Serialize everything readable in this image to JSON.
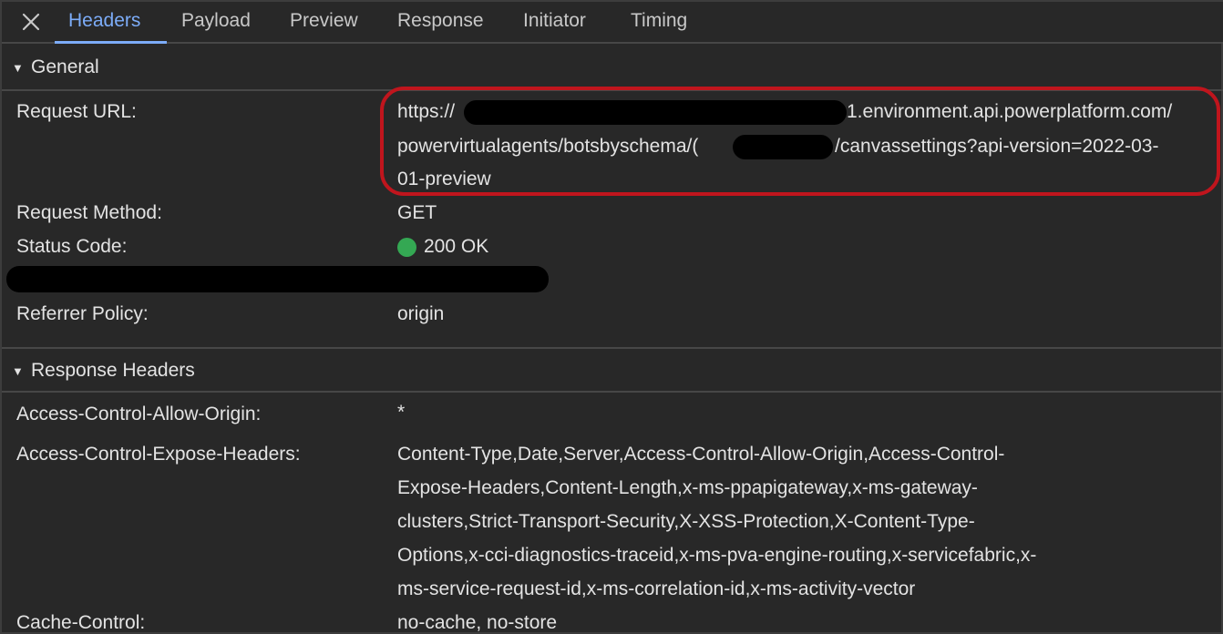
{
  "tabs": [
    {
      "label": "Headers",
      "active": true
    },
    {
      "label": "Payload",
      "active": false
    },
    {
      "label": "Preview",
      "active": false
    },
    {
      "label": "Response",
      "active": false
    },
    {
      "label": "Initiator",
      "active": false
    },
    {
      "label": "Timing",
      "active": false
    }
  ],
  "close_icon": "close-icon",
  "general": {
    "title": "General",
    "request_url_label": "Request URL:",
    "request_url_lines": [
      {
        "prefix": "https://",
        "suffix": "1.environment.api.powerplatform.com/"
      },
      {
        "prefix": "powervirtualagents/botsbyschema/(",
        "suffix": "/canvassettings?api-version=2022-03-"
      },
      {
        "prefix": "01-preview",
        "suffix": ""
      }
    ],
    "request_method_label": "Request Method:",
    "request_method": "GET",
    "status_code_label": "Status Code:",
    "status_code": "200 OK",
    "status_color": "#34a853",
    "referrer_policy_label": "Referrer Policy:",
    "referrer_policy": "origin"
  },
  "response_headers": {
    "title": "Response Headers",
    "acao_label": "Access-Control-Allow-Origin:",
    "acao_value": "*",
    "aceh_label": "Access-Control-Expose-Headers:",
    "aceh_lines": [
      "Content-Type,Date,Server,Access-Control-Allow-Origin,Access-Control-",
      "Expose-Headers,Content-Length,x-ms-ppapigateway,x-ms-gateway-",
      "clusters,Strict-Transport-Security,X-XSS-Protection,X-Content-Type-",
      "Options,x-cci-diagnostics-traceid,x-ms-pva-engine-routing,x-servicefabric,x-",
      "ms-service-request-id,x-ms-correlation-id,x-ms-activity-vector"
    ],
    "cache_control_label": "Cache-Control:",
    "cache_control_value": "no-cache, no-store"
  },
  "colors": {
    "background": "#282828",
    "accent": "#7cacf8",
    "highlight": "#c0151d",
    "text": "#e3e3e3"
  }
}
